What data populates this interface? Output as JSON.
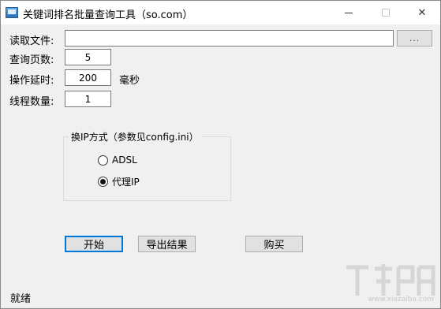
{
  "window": {
    "title": "关键词排名批量查询工具（so.com）",
    "controls": {
      "minimize": "—",
      "maximize": "□",
      "close": "✕"
    }
  },
  "form": {
    "read_file_label": "读取文件:",
    "read_file_value": "",
    "browse_label": "...",
    "pages_label": "查询页数:",
    "pages_value": "5",
    "delay_label": "操作延时:",
    "delay_value": "200",
    "delay_unit": "毫秒",
    "threads_label": "线程数量:",
    "threads_value": "1"
  },
  "ip_group": {
    "title": "换IP方式（参数见config.ini）",
    "options": [
      {
        "label": "ADSL",
        "checked": false
      },
      {
        "label": "代理IP",
        "checked": true
      }
    ]
  },
  "actions": {
    "start": "开始",
    "export": "导出结果",
    "buy": "购买"
  },
  "status": {
    "text": "就绪"
  },
  "watermark": {
    "text": "www.xiazaiba.com"
  }
}
